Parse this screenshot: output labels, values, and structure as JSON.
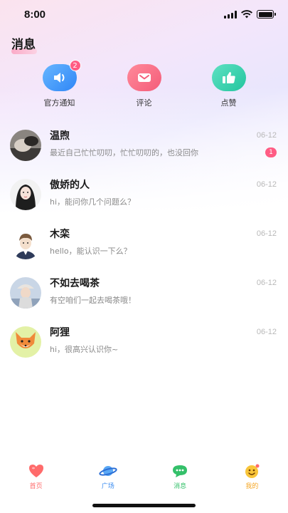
{
  "status_bar": {
    "time": "8:00"
  },
  "page": {
    "title": "消息"
  },
  "quick_actions": [
    {
      "label": "官方通知",
      "icon": "speaker-icon",
      "badge": "2",
      "color": "#2f86f6"
    },
    {
      "label": "评论",
      "icon": "envelope-icon",
      "color": "#f45c79"
    },
    {
      "label": "点赞",
      "icon": "thumbs-up-icon",
      "color": "#23c59e"
    }
  ],
  "messages": [
    {
      "name": "温煦",
      "time": "06-12",
      "preview": "最近自己忙忙叨叨，忙忙叨叨的，也没回你",
      "unread": "1"
    },
    {
      "name": "傲娇的人",
      "time": "06-12",
      "preview": "hi，能问你几个问题么？"
    },
    {
      "name": "木栾",
      "time": "06-12",
      "preview": "hello，能认识一下么？"
    },
    {
      "name": "不如去喝茶",
      "time": "06-12",
      "preview": "有空咱们一起去喝茶哦！"
    },
    {
      "name": "阿狸",
      "time": "06-12",
      "preview": "hi，很高兴认识你~"
    }
  ],
  "tab_bar": [
    {
      "label": "首页",
      "icon": "heart-icon",
      "color": "#ff6b6b"
    },
    {
      "label": "广场",
      "icon": "planet-icon",
      "color": "#3a8cf0"
    },
    {
      "label": "消息",
      "icon": "chat-bubble-icon",
      "color": "#34c06a",
      "active": true
    },
    {
      "label": "我的",
      "icon": "smiley-icon",
      "color": "#f5a623"
    }
  ]
}
